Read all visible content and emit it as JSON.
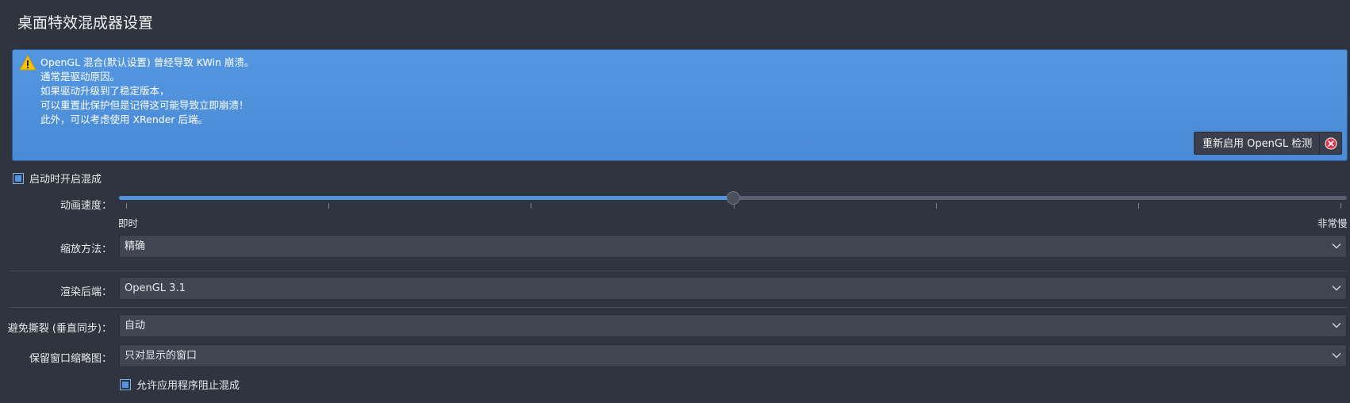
{
  "page": {
    "title": "桌面特效混成器设置"
  },
  "banner": {
    "icon": "warning-icon",
    "lines": [
      "OpenGL 混合(默认设置) 曾经导致 KWin 崩溃。",
      "通常是驱动原因。",
      "如果驱动升级到了稳定版本，",
      "可以重置此保护但是记得这可能导致立即崩溃！",
      "此外，可以考虑使用 XRender 后端。"
    ],
    "reenable_label": "重新启用 OpenGL 检测",
    "close_icon": "close-icon",
    "accent": "#5294e2"
  },
  "enable_on_startup": {
    "label": "启动时开启混成",
    "checked": true
  },
  "animation_speed": {
    "label": "动画速度：",
    "min_label": "即时",
    "max_label": "非常慢",
    "value_fraction": 0.5,
    "tick_count": 7
  },
  "scale_method": {
    "label": "缩放方法：",
    "value": "精确"
  },
  "rendering_backend": {
    "label": "渲染后端：",
    "value": "OpenGL 3.1"
  },
  "tearing_prevention": {
    "label": "避免撕裂 (垂直同步)：",
    "value": "自动"
  },
  "keep_thumbnails": {
    "label": "保留窗口缩略图：",
    "value": "只对显示的窗口"
  },
  "allow_block": {
    "label": "允许应用程序阻止混成",
    "checked": true
  }
}
